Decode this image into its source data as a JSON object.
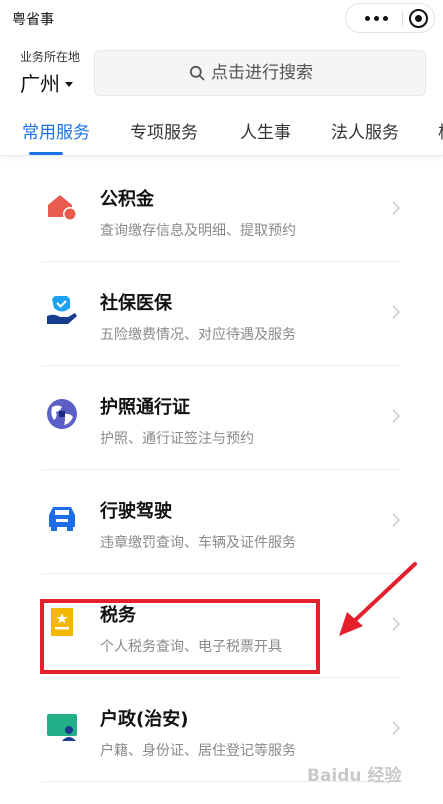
{
  "app": {
    "title": "粤省事"
  },
  "location": {
    "label": "业务所在地",
    "city": "广州"
  },
  "search": {
    "placeholder": "点击进行搜索"
  },
  "tabs": [
    {
      "label": "常用服务",
      "active": true
    },
    {
      "label": "专项服务",
      "active": false
    },
    {
      "label": "人生事",
      "active": false
    },
    {
      "label": "法人服务",
      "active": false
    },
    {
      "label": "极",
      "active": false
    }
  ],
  "services": [
    {
      "title": "公积金",
      "desc": "查询缴存信息及明细、提取预约",
      "icon": "house-fund-icon",
      "color": "#e95b4f"
    },
    {
      "title": "社保医保",
      "desc": "五险缴费情况、对应待遇及服务",
      "icon": "social-security-shield-icon",
      "color": "#1da1f2"
    },
    {
      "title": "护照通行证",
      "desc": "护照、通行证签注与预约",
      "icon": "passport-globe-icon",
      "color": "#5b5fc7"
    },
    {
      "title": "行驶驾驶",
      "desc": "违章缴罚查询、车辆及证件服务",
      "icon": "car-icon",
      "color": "#1b6ee8"
    },
    {
      "title": "税务",
      "desc": "个人税务查询、电子税票开具",
      "icon": "tax-badge-icon",
      "color": "#f5b800"
    },
    {
      "title": "户政(治安)",
      "desc": "户籍、身份证、居住登记等服务",
      "icon": "household-id-icon",
      "color": "#23b089"
    }
  ],
  "colors": {
    "accent": "#1b73e8",
    "highlight": "#e3202c"
  },
  "watermark": "Baidu 经验"
}
